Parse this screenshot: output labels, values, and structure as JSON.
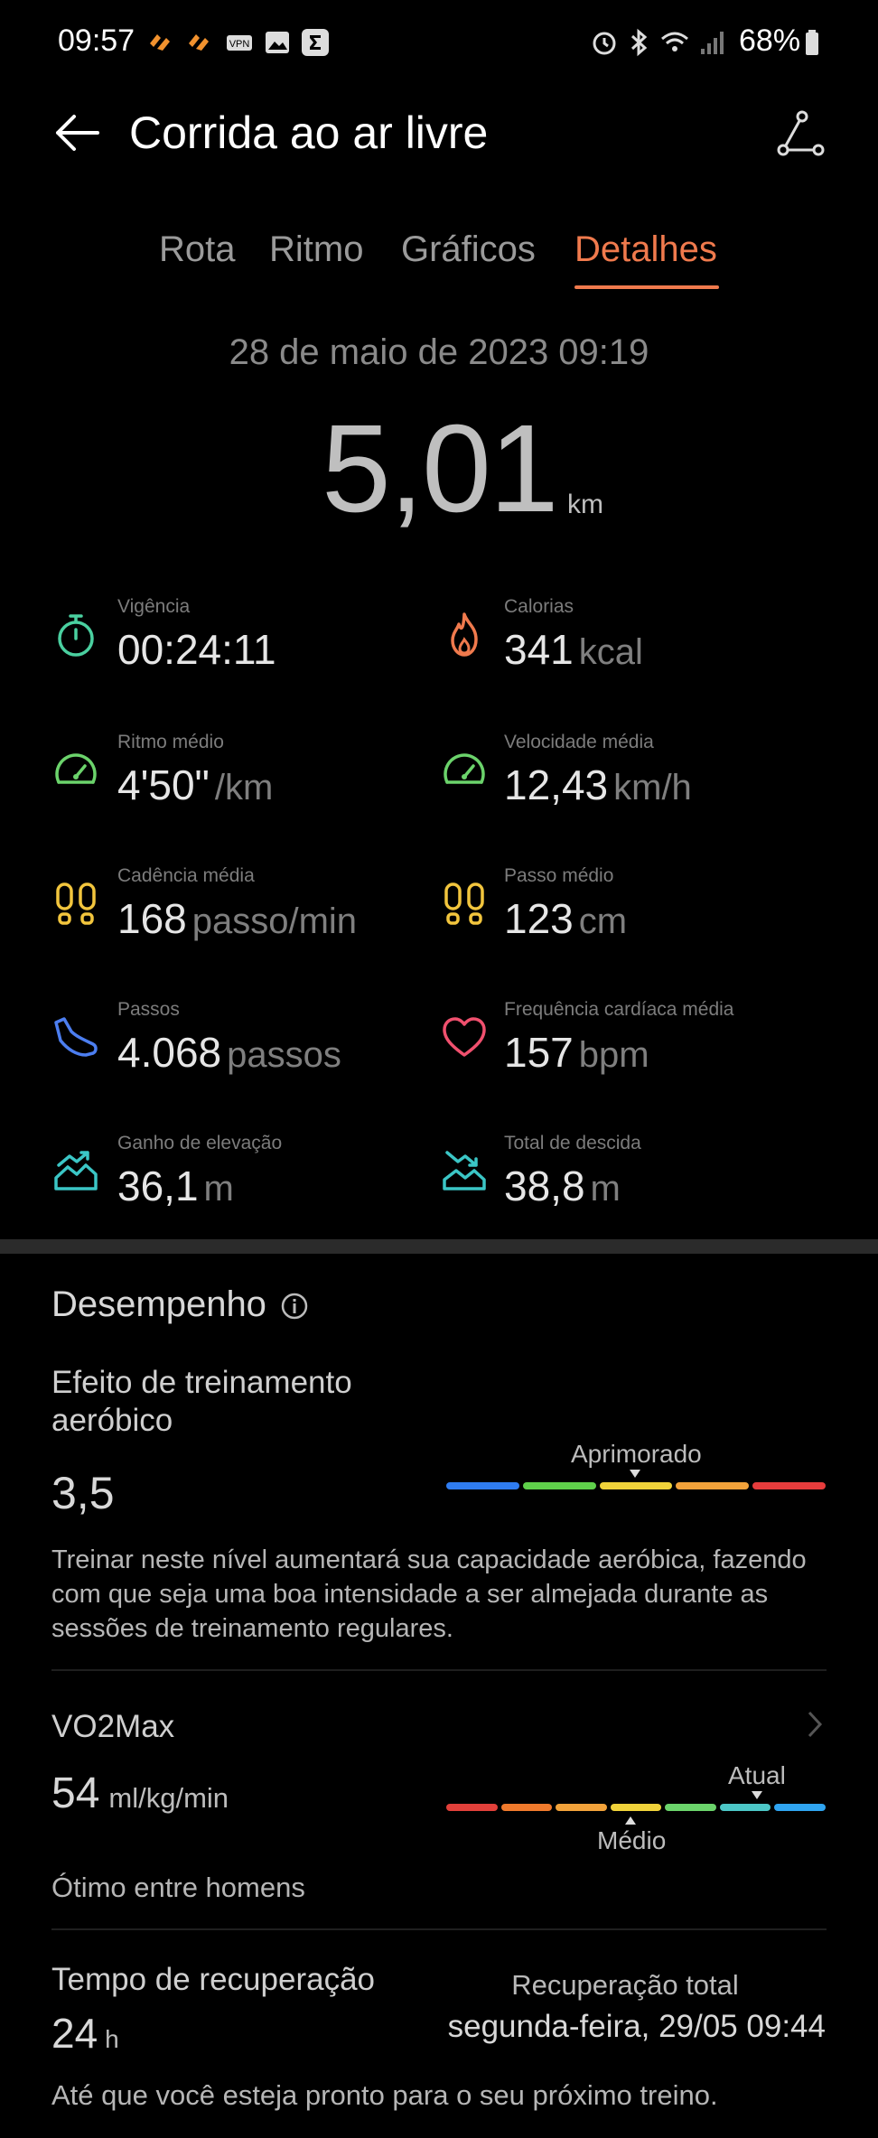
{
  "status_bar": {
    "time": "09:57",
    "battery": "68%",
    "icons": [
      "app-icon",
      "app-icon",
      "vpn-icon",
      "gallery-icon",
      "sum-icon",
      "alarm-icon",
      "bluetooth-icon",
      "wifi-icon",
      "signal-icon",
      "battery-icon"
    ]
  },
  "header": {
    "title": "Corrida ao ar livre",
    "back_icon": "arrow-left-icon",
    "route_icon": "route-icon"
  },
  "tabs": [
    {
      "label": "Rota",
      "active": false
    },
    {
      "label": "Ritmo",
      "active": false
    },
    {
      "label": "Gráficos",
      "active": false
    },
    {
      "label": "Detalhes",
      "active": true
    }
  ],
  "summary": {
    "date": "28 de maio de 2023 09:19",
    "distance": "5,01",
    "distance_unit": "km"
  },
  "stats": [
    {
      "label": "Vigência",
      "value": "00:24:11",
      "unit": "",
      "icon": "stopwatch-icon",
      "color": "#4ad0a0"
    },
    {
      "label": "Calorias",
      "value": "341",
      "unit": "kcal",
      "icon": "flame-icon",
      "color": "#f07a4d"
    },
    {
      "label": "Ritmo médio",
      "value": "4'50\"",
      "unit": "/km",
      "icon": "speedometer-icon",
      "color": "#6bd36b"
    },
    {
      "label": "Velocidade média",
      "value": "12,43",
      "unit": "km/h",
      "icon": "speedometer-icon",
      "color": "#6bd36b"
    },
    {
      "label": "Cadência média",
      "value": "168",
      "unit": "passo/min",
      "icon": "footprints-icon",
      "color": "#f2c53d"
    },
    {
      "label": "Passo médio",
      "value": "123",
      "unit": "cm",
      "icon": "footprints-icon",
      "color": "#f2c53d"
    },
    {
      "label": "Passos",
      "value": "4.068",
      "unit": "passos",
      "icon": "shoe-icon",
      "color": "#4c7ef0"
    },
    {
      "label": "Frequência cardíaca média",
      "value": "157",
      "unit": "bpm",
      "icon": "heart-icon",
      "color": "#f0506e"
    },
    {
      "label": "Ganho de elevação",
      "value": "36,1",
      "unit": "m",
      "icon": "elevation-up-icon",
      "color": "#3bc6c6"
    },
    {
      "label": "Total de descida",
      "value": "38,8",
      "unit": "m",
      "icon": "elevation-down-icon",
      "color": "#3bc6c6"
    }
  ],
  "performance": {
    "title": "Desempenho",
    "info_icon": "info-icon",
    "aerobic": {
      "label": "Efeito de treinamento aeróbico",
      "value": "3,5",
      "scale_label": "Aprimorado",
      "scale_colors": [
        "#2f7cf0",
        "#5fd04a",
        "#f0d23a",
        "#f2a23a",
        "#e63c3c"
      ],
      "description": "Treinar neste nível aumentará sua capacidade aeróbica, fazendo com que seja uma boa intensidade a ser almejada durante as sessões de treinamento regulares."
    },
    "vo2max": {
      "label": "VO2Max",
      "value": "54",
      "unit": "ml/kg/min",
      "current_label": "Atual",
      "average_label": "Médio",
      "scale_colors": [
        "#e2403a",
        "#f07a2c",
        "#f2a23a",
        "#f0d23a",
        "#6bd36b",
        "#4cc6c6",
        "#2fa4f0"
      ],
      "note": "Ótimo entre homens"
    },
    "recovery": {
      "label": "Tempo de recuperação",
      "value": "24",
      "unit": "h",
      "total_label": "Recuperação total",
      "total_value": "segunda-feira, 29/05 09:44",
      "note": "Até que você esteja pronto para o seu próximo treino."
    }
  }
}
